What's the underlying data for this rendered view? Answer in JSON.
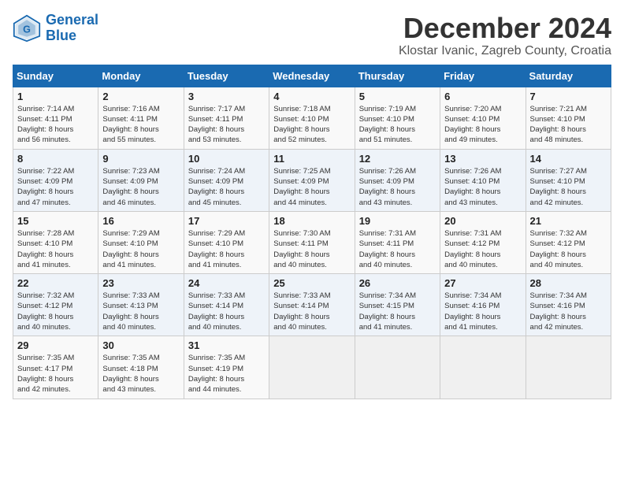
{
  "header": {
    "logo_line1": "General",
    "logo_line2": "Blue",
    "month_title": "December 2024",
    "subtitle": "Klostar Ivanic, Zagreb County, Croatia"
  },
  "weekdays": [
    "Sunday",
    "Monday",
    "Tuesday",
    "Wednesday",
    "Thursday",
    "Friday",
    "Saturday"
  ],
  "weeks": [
    [
      {
        "day": "1",
        "info": "Sunrise: 7:14 AM\nSunset: 4:11 PM\nDaylight: 8 hours\nand 56 minutes."
      },
      {
        "day": "2",
        "info": "Sunrise: 7:16 AM\nSunset: 4:11 PM\nDaylight: 8 hours\nand 55 minutes."
      },
      {
        "day": "3",
        "info": "Sunrise: 7:17 AM\nSunset: 4:11 PM\nDaylight: 8 hours\nand 53 minutes."
      },
      {
        "day": "4",
        "info": "Sunrise: 7:18 AM\nSunset: 4:10 PM\nDaylight: 8 hours\nand 52 minutes."
      },
      {
        "day": "5",
        "info": "Sunrise: 7:19 AM\nSunset: 4:10 PM\nDaylight: 8 hours\nand 51 minutes."
      },
      {
        "day": "6",
        "info": "Sunrise: 7:20 AM\nSunset: 4:10 PM\nDaylight: 8 hours\nand 49 minutes."
      },
      {
        "day": "7",
        "info": "Sunrise: 7:21 AM\nSunset: 4:10 PM\nDaylight: 8 hours\nand 48 minutes."
      }
    ],
    [
      {
        "day": "8",
        "info": "Sunrise: 7:22 AM\nSunset: 4:09 PM\nDaylight: 8 hours\nand 47 minutes."
      },
      {
        "day": "9",
        "info": "Sunrise: 7:23 AM\nSunset: 4:09 PM\nDaylight: 8 hours\nand 46 minutes."
      },
      {
        "day": "10",
        "info": "Sunrise: 7:24 AM\nSunset: 4:09 PM\nDaylight: 8 hours\nand 45 minutes."
      },
      {
        "day": "11",
        "info": "Sunrise: 7:25 AM\nSunset: 4:09 PM\nDaylight: 8 hours\nand 44 minutes."
      },
      {
        "day": "12",
        "info": "Sunrise: 7:26 AM\nSunset: 4:09 PM\nDaylight: 8 hours\nand 43 minutes."
      },
      {
        "day": "13",
        "info": "Sunrise: 7:26 AM\nSunset: 4:10 PM\nDaylight: 8 hours\nand 43 minutes."
      },
      {
        "day": "14",
        "info": "Sunrise: 7:27 AM\nSunset: 4:10 PM\nDaylight: 8 hours\nand 42 minutes."
      }
    ],
    [
      {
        "day": "15",
        "info": "Sunrise: 7:28 AM\nSunset: 4:10 PM\nDaylight: 8 hours\nand 41 minutes."
      },
      {
        "day": "16",
        "info": "Sunrise: 7:29 AM\nSunset: 4:10 PM\nDaylight: 8 hours\nand 41 minutes."
      },
      {
        "day": "17",
        "info": "Sunrise: 7:29 AM\nSunset: 4:10 PM\nDaylight: 8 hours\nand 41 minutes."
      },
      {
        "day": "18",
        "info": "Sunrise: 7:30 AM\nSunset: 4:11 PM\nDaylight: 8 hours\nand 40 minutes."
      },
      {
        "day": "19",
        "info": "Sunrise: 7:31 AM\nSunset: 4:11 PM\nDaylight: 8 hours\nand 40 minutes."
      },
      {
        "day": "20",
        "info": "Sunrise: 7:31 AM\nSunset: 4:12 PM\nDaylight: 8 hours\nand 40 minutes."
      },
      {
        "day": "21",
        "info": "Sunrise: 7:32 AM\nSunset: 4:12 PM\nDaylight: 8 hours\nand 40 minutes."
      }
    ],
    [
      {
        "day": "22",
        "info": "Sunrise: 7:32 AM\nSunset: 4:12 PM\nDaylight: 8 hours\nand 40 minutes."
      },
      {
        "day": "23",
        "info": "Sunrise: 7:33 AM\nSunset: 4:13 PM\nDaylight: 8 hours\nand 40 minutes."
      },
      {
        "day": "24",
        "info": "Sunrise: 7:33 AM\nSunset: 4:14 PM\nDaylight: 8 hours\nand 40 minutes."
      },
      {
        "day": "25",
        "info": "Sunrise: 7:33 AM\nSunset: 4:14 PM\nDaylight: 8 hours\nand 40 minutes."
      },
      {
        "day": "26",
        "info": "Sunrise: 7:34 AM\nSunset: 4:15 PM\nDaylight: 8 hours\nand 41 minutes."
      },
      {
        "day": "27",
        "info": "Sunrise: 7:34 AM\nSunset: 4:16 PM\nDaylight: 8 hours\nand 41 minutes."
      },
      {
        "day": "28",
        "info": "Sunrise: 7:34 AM\nSunset: 4:16 PM\nDaylight: 8 hours\nand 42 minutes."
      }
    ],
    [
      {
        "day": "29",
        "info": "Sunrise: 7:35 AM\nSunset: 4:17 PM\nDaylight: 8 hours\nand 42 minutes."
      },
      {
        "day": "30",
        "info": "Sunrise: 7:35 AM\nSunset: 4:18 PM\nDaylight: 8 hours\nand 43 minutes."
      },
      {
        "day": "31",
        "info": "Sunrise: 7:35 AM\nSunset: 4:19 PM\nDaylight: 8 hours\nand 44 minutes."
      },
      {
        "day": "",
        "info": ""
      },
      {
        "day": "",
        "info": ""
      },
      {
        "day": "",
        "info": ""
      },
      {
        "day": "",
        "info": ""
      }
    ]
  ]
}
